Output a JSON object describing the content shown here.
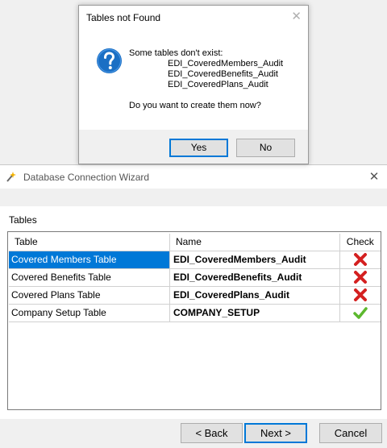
{
  "dialog": {
    "title": "Tables not Found",
    "message": "Some tables don't exist:",
    "tables": [
      "EDI_CoveredMembers_Audit",
      "EDI_CoveredBenefits_Audit",
      "EDI_CoveredPlans_Audit"
    ],
    "question": "Do you want to create them now?",
    "yes_label": "Yes",
    "no_label": "No",
    "close_glyph": "✕",
    "icon": "question-icon"
  },
  "wizard": {
    "title": "Database Connection Wizard",
    "close_glyph": "✕",
    "section_label": "Tables",
    "columns": {
      "table": "Table",
      "name": "Name",
      "check": "Check"
    },
    "rows": [
      {
        "table": "Covered Members Table",
        "name": "EDI_CoveredMembers_Audit",
        "check": "fail",
        "selected": true
      },
      {
        "table": "Covered Benefits Table",
        "name": "EDI_CoveredBenefits_Audit",
        "check": "fail",
        "selected": false
      },
      {
        "table": "Covered Plans Table",
        "name": "EDI_CoveredPlans_Audit",
        "check": "fail",
        "selected": false
      },
      {
        "table": "Company Setup Table",
        "name": "COMPANY_SETUP",
        "check": "ok",
        "selected": false
      }
    ],
    "back_label": "<   Back",
    "next_label": "Next   >",
    "cancel_label": "Cancel"
  },
  "colors": {
    "selection": "#0078d7",
    "fail": "#d42020",
    "ok": "#5cb82e"
  }
}
